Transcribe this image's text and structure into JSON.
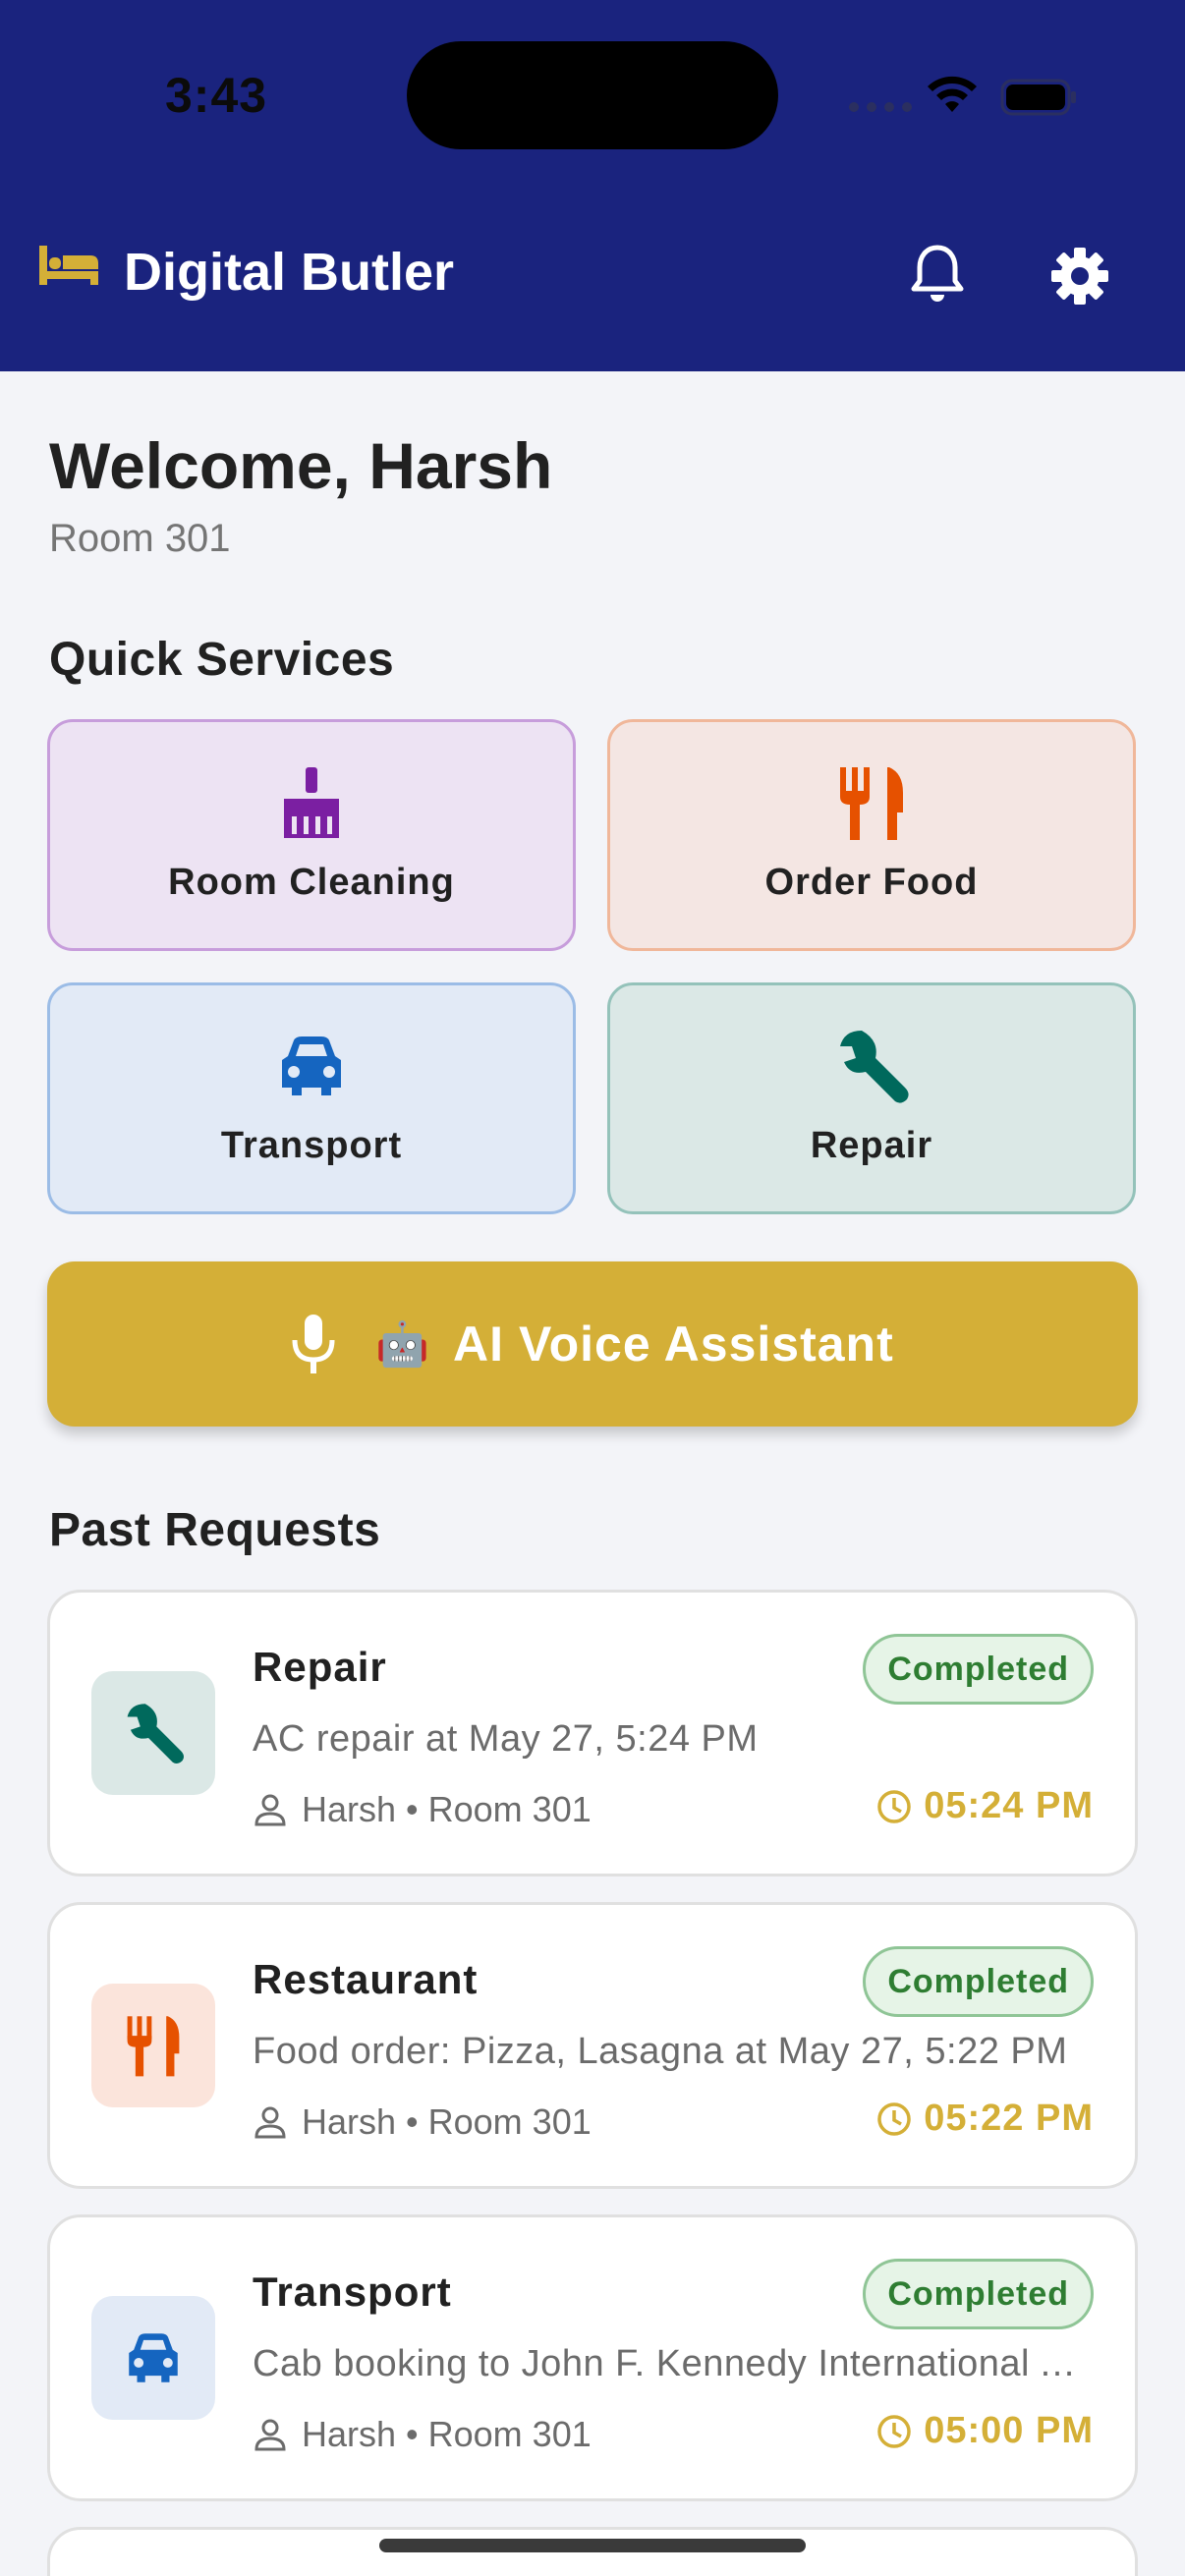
{
  "status": {
    "time": "3:43"
  },
  "app": {
    "title": "Digital Butler",
    "brand_color": "#1a237e",
    "accent_color": "#d4af37"
  },
  "header": {
    "icons": {
      "logo": "bed-icon",
      "notifications": "bell-icon",
      "settings": "gear-icon"
    }
  },
  "welcome": {
    "greeting": "Welcome, Harsh",
    "room": "Room 301"
  },
  "quick_services": {
    "title": "Quick Services",
    "items": [
      {
        "label": "Room Cleaning",
        "icon": "broom-icon",
        "color": "#7b1fa2"
      },
      {
        "label": "Order Food",
        "icon": "fork-knife-icon",
        "color": "#e65100"
      },
      {
        "label": "Transport",
        "icon": "car-icon",
        "color": "#1565c0"
      },
      {
        "label": "Repair",
        "icon": "wrench-icon",
        "color": "#00695c"
      }
    ]
  },
  "assistant": {
    "label": "AI Voice Assistant",
    "robot": "🤖"
  },
  "past_requests": {
    "title": "Past Requests",
    "items": [
      {
        "title": "Repair",
        "description": "AC repair at May 27, 5:24 PM",
        "meta": "Harsh • Room 301",
        "status": "Completed",
        "time": "05:24 PM"
      },
      {
        "title": "Restaurant",
        "description": "Food order: Pizza, Lasagna at May 27, 5:22 PM",
        "meta": "Harsh • Room 301",
        "status": "Completed",
        "time": "05:22 PM"
      },
      {
        "title": "Transport",
        "description": "Cab booking to John F. Kennedy International Airport",
        "meta": "Harsh • Room 301",
        "status": "Completed",
        "time": "05:00 PM"
      }
    ]
  }
}
